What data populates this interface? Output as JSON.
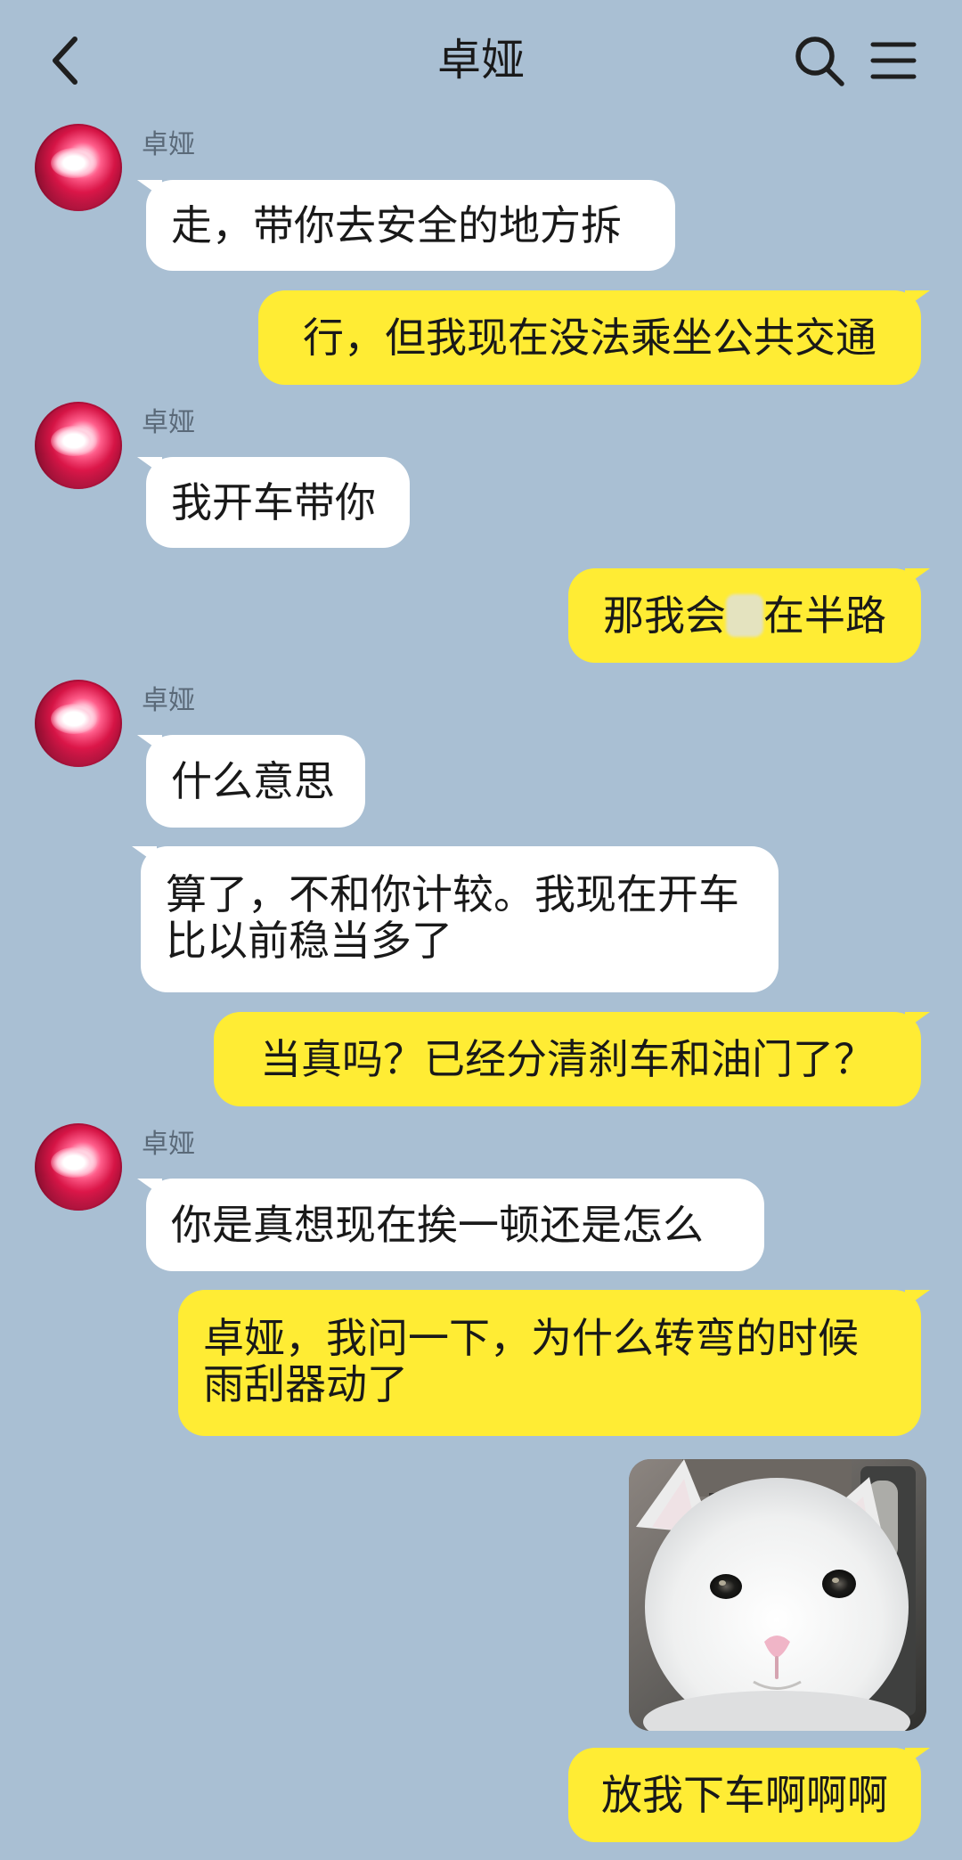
{
  "header": {
    "title": "卓娅",
    "back_icon": "chevron-left-icon",
    "search_icon": "search-icon",
    "menu_icon": "hamburger-menu-icon"
  },
  "messages": [
    {
      "sender": "卓娅",
      "side": "left",
      "text": "走，带你去安全的地方拆"
    },
    {
      "side": "right",
      "text": "行，但我现在没法乘坐公共交通"
    },
    {
      "sender": "卓娅",
      "side": "left",
      "text": "我开车带你"
    },
    {
      "side": "right",
      "text_before": "那我会",
      "text_after": "在半路"
    },
    {
      "sender": "卓娅",
      "side": "left",
      "text": "什么意思"
    },
    {
      "side": "left",
      "text": "算了，不和你计较。我现在开车比以前稳当多了"
    },
    {
      "side": "right",
      "text": "当真吗？已经分清刹车和油门了？"
    },
    {
      "sender": "卓娅",
      "side": "left",
      "text": "你是真想现在挨一顿还是怎么"
    },
    {
      "side": "right",
      "text": "卓娅，我问一下，为什么转弯的时候雨刮器动了"
    },
    {
      "side": "right",
      "image": "cat-face-image"
    },
    {
      "side": "right",
      "text": "放我下车啊啊啊"
    }
  ],
  "colors": {
    "background": "#a9bfd3",
    "left_bubble": "#ffffff",
    "right_bubble": "#ffec34",
    "text": "#191919",
    "sender_name": "#5a6978"
  }
}
